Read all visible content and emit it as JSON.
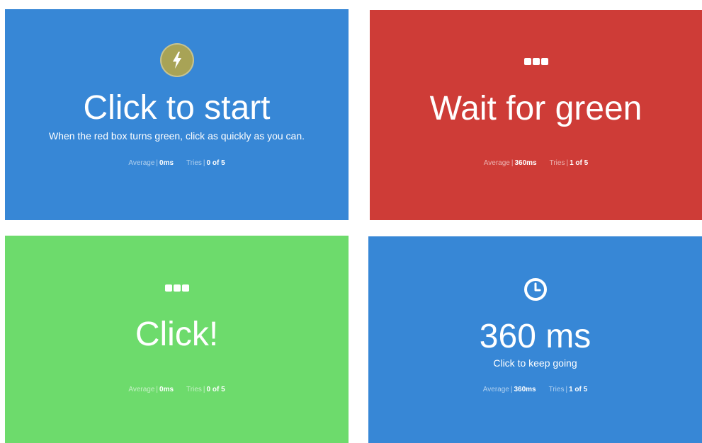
{
  "colors": {
    "start_bg": "#3787d6",
    "wait_bg": "#ce3c37",
    "click_bg": "#6ddb6c",
    "result_bg": "#3787d6",
    "bolt_icon_bg": "#a8a356"
  },
  "panels": {
    "start": {
      "icon": "lightning-bolt-icon",
      "heading": "Click to start",
      "subtext": "When the red box turns green, click as quickly as you can.",
      "average_label": "Average",
      "average_value": "0ms",
      "tries_label": "Tries",
      "tries_value": "0 of 5"
    },
    "wait": {
      "icon": "ellipsis-icon",
      "heading": "Wait for green",
      "average_label": "Average",
      "average_value": "360ms",
      "tries_label": "Tries",
      "tries_value": "1 of 5"
    },
    "click": {
      "icon": "ellipsis-icon",
      "heading": "Click!",
      "average_label": "Average",
      "average_value": "0ms",
      "tries_label": "Tries",
      "tries_value": "0 of 5"
    },
    "result": {
      "icon": "clock-icon",
      "heading": "360 ms",
      "subtext": "Click to keep going",
      "average_label": "Average",
      "average_value": "360ms",
      "tries_label": "Tries",
      "tries_value": "1 of 5"
    }
  },
  "separator": "|"
}
